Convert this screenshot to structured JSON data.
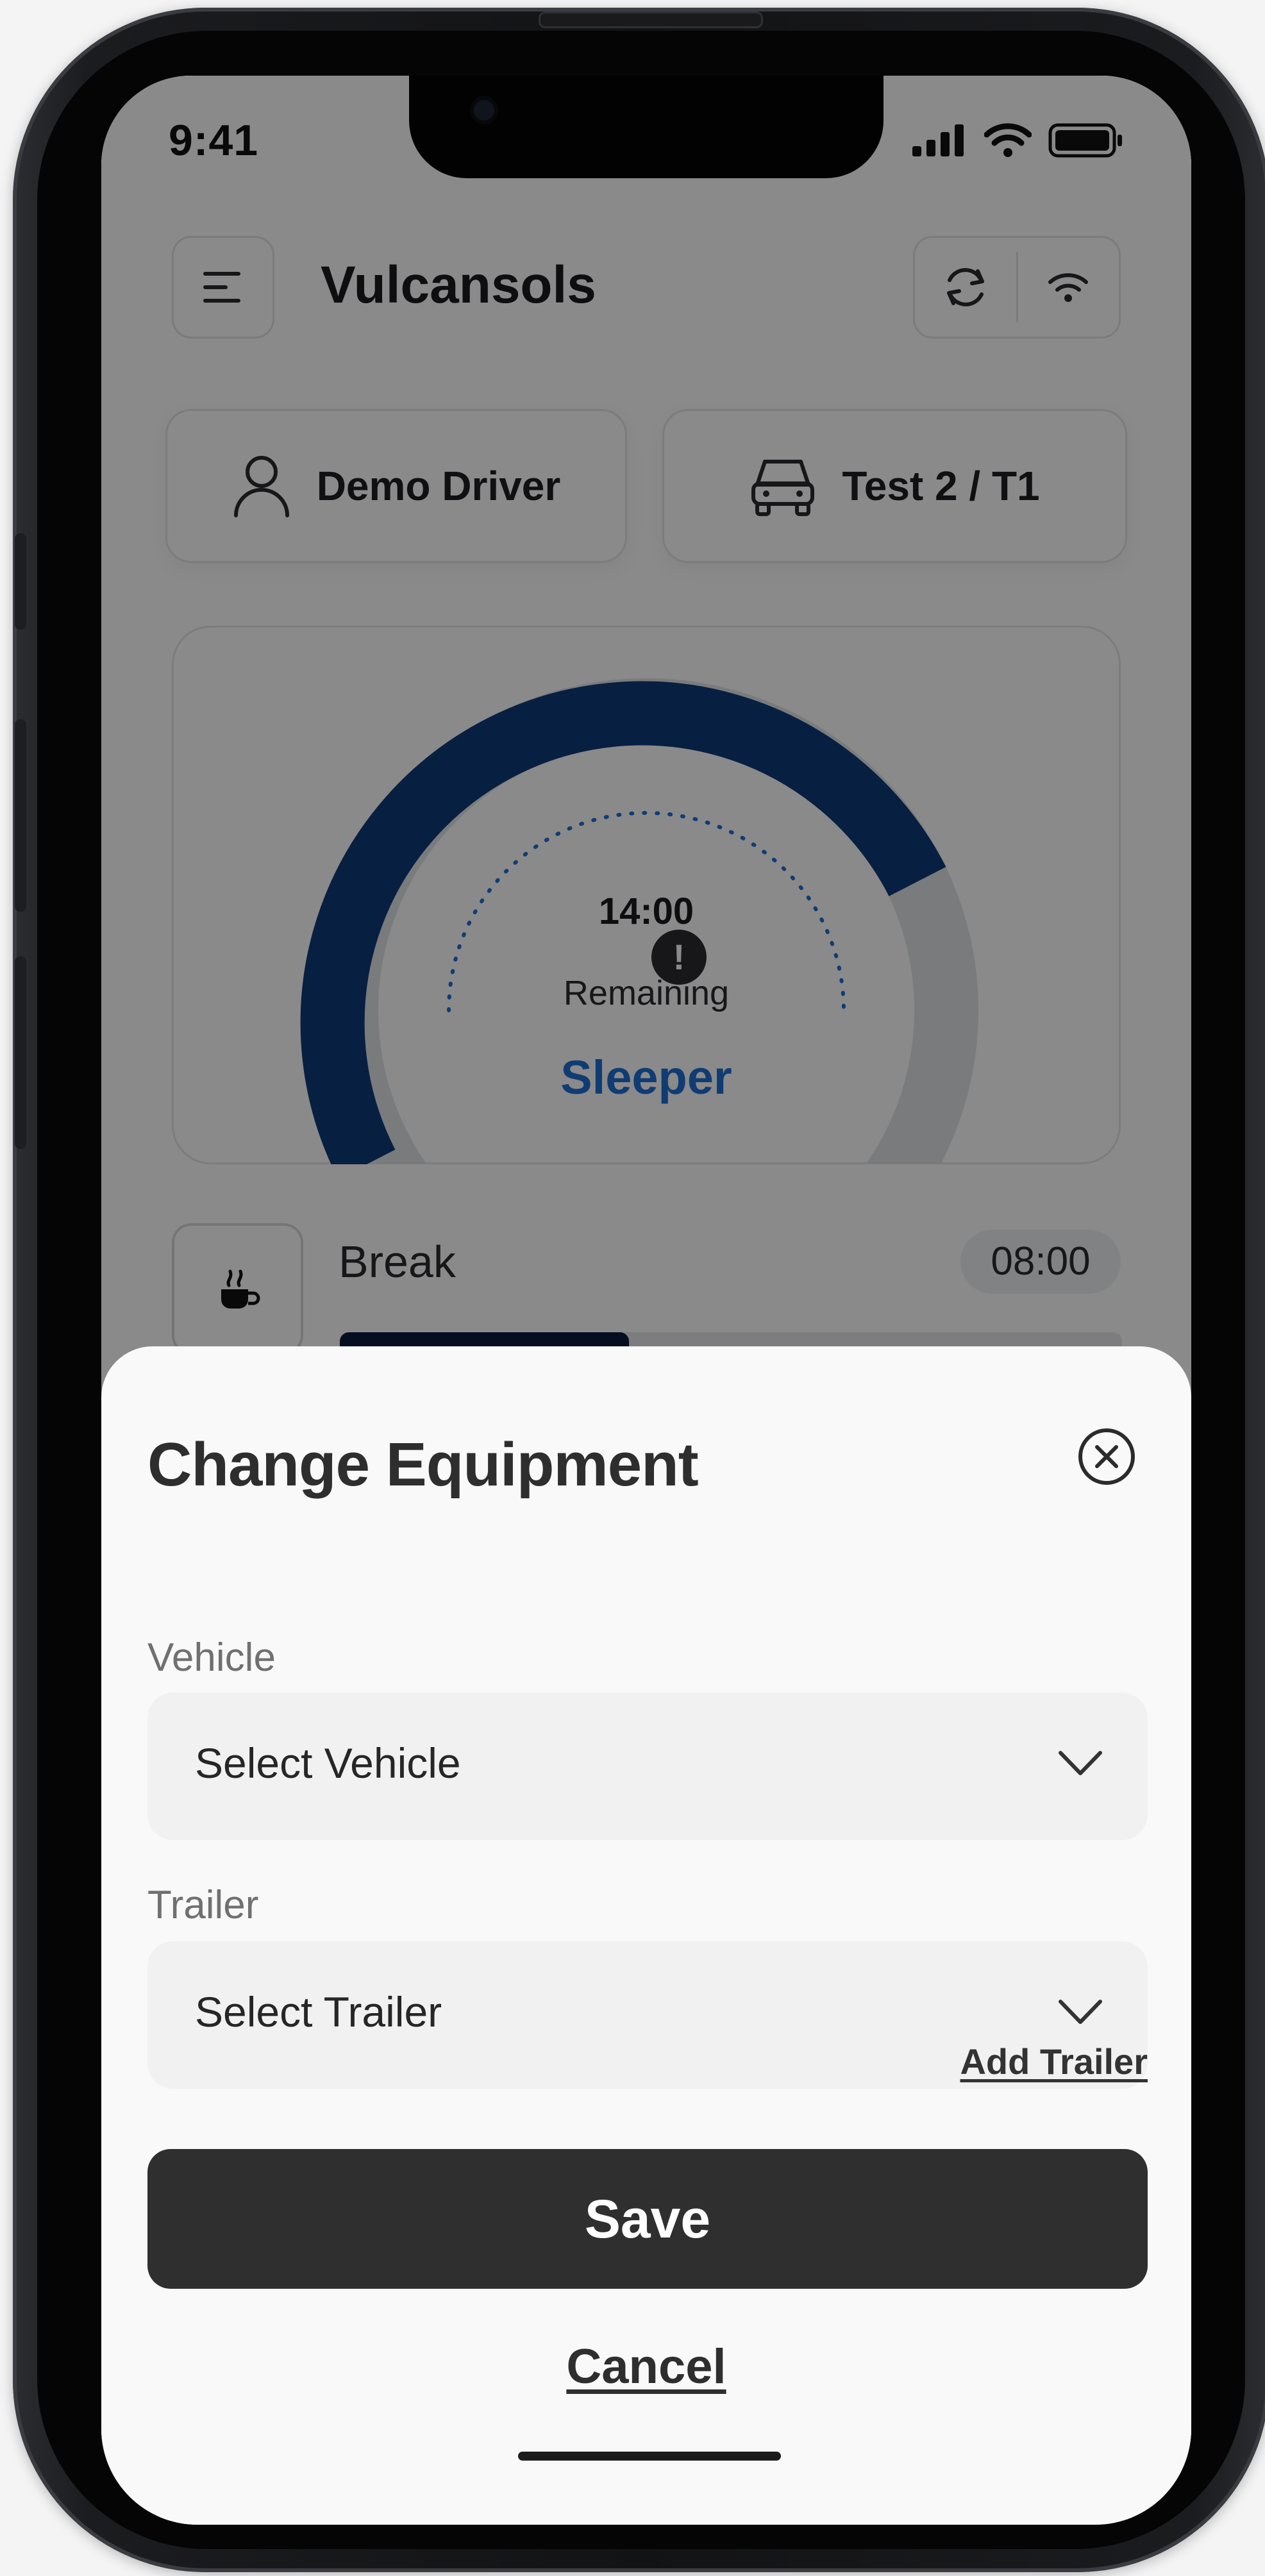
{
  "status_bar": {
    "time": "9:41"
  },
  "header": {
    "title": "Vulcansols"
  },
  "driver_card": {
    "name": "Demo Driver"
  },
  "vehicle_card": {
    "label": "Test 2 / T1"
  },
  "gauge": {
    "time": "14:00",
    "remaining_label": "Remaining",
    "status": "Sleeper",
    "alert_glyph": "!",
    "accent_color": "#0d3a78",
    "status_color": "#1f6fd6"
  },
  "break_row": {
    "label": "Break",
    "time": "08:00",
    "progress": 0.37
  },
  "sheet": {
    "title": "Change Equipment",
    "vehicle_label": "Vehicle",
    "vehicle_placeholder": "Select Vehicle",
    "trailer_label": "Trailer",
    "trailer_placeholder": "Select Trailer",
    "add_trailer": "Add Trailer",
    "save": "Save",
    "cancel": "Cancel"
  }
}
